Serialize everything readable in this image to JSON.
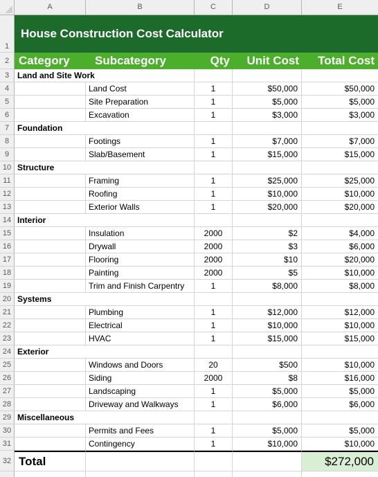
{
  "app": {
    "type": "spreadsheet",
    "colors": {
      "title_bar": "#1d6b2b",
      "header_bar": "#4caf2c",
      "total_highlight": "#d9efd3",
      "gutter": "#efefef",
      "gridline": "#d4d4d4"
    }
  },
  "column_headers": [
    "A",
    "B",
    "C",
    "D",
    "E"
  ],
  "title": {
    "row": "1",
    "text": "House Construction Cost Calculator"
  },
  "table_header": {
    "row": "2",
    "columns": [
      "Category",
      "Subcategory",
      "Qty",
      "Unit Cost",
      "Total Cost"
    ]
  },
  "rows": [
    {
      "row": "3",
      "type": "category",
      "category": "Land and Site Work"
    },
    {
      "row": "4",
      "type": "item",
      "subcategory": "Land Cost",
      "qty": "1",
      "unit_cost": "$50,000",
      "total_cost": "$50,000"
    },
    {
      "row": "5",
      "type": "item",
      "subcategory": "Site Preparation",
      "qty": "1",
      "unit_cost": "$5,000",
      "total_cost": "$5,000"
    },
    {
      "row": "6",
      "type": "item",
      "subcategory": "Excavation",
      "qty": "1",
      "unit_cost": "$3,000",
      "total_cost": "$3,000"
    },
    {
      "row": "7",
      "type": "category",
      "category": "Foundation"
    },
    {
      "row": "8",
      "type": "item",
      "subcategory": "Footings",
      "qty": "1",
      "unit_cost": "$7,000",
      "total_cost": "$7,000"
    },
    {
      "row": "9",
      "type": "item",
      "subcategory": "Slab/Basement",
      "qty": "1",
      "unit_cost": "$15,000",
      "total_cost": "$15,000"
    },
    {
      "row": "10",
      "type": "category",
      "category": "Structure"
    },
    {
      "row": "11",
      "type": "item",
      "subcategory": "Framing",
      "qty": "1",
      "unit_cost": "$25,000",
      "total_cost": "$25,000"
    },
    {
      "row": "12",
      "type": "item",
      "subcategory": "Roofing",
      "qty": "1",
      "unit_cost": "$10,000",
      "total_cost": "$10,000"
    },
    {
      "row": "13",
      "type": "item",
      "subcategory": "Exterior Walls",
      "qty": "1",
      "unit_cost": "$20,000",
      "total_cost": "$20,000"
    },
    {
      "row": "14",
      "type": "category",
      "category": "Interior"
    },
    {
      "row": "15",
      "type": "item",
      "subcategory": "Insulation",
      "qty": "2000",
      "unit_cost": "$2",
      "total_cost": "$4,000"
    },
    {
      "row": "16",
      "type": "item",
      "subcategory": "Drywall",
      "qty": "2000",
      "unit_cost": "$3",
      "total_cost": "$6,000"
    },
    {
      "row": "17",
      "type": "item",
      "subcategory": "Flooring",
      "qty": "2000",
      "unit_cost": "$10",
      "total_cost": "$20,000"
    },
    {
      "row": "18",
      "type": "item",
      "subcategory": "Painting",
      "qty": "2000",
      "unit_cost": "$5",
      "total_cost": "$10,000"
    },
    {
      "row": "19",
      "type": "item",
      "subcategory": "Trim and Finish Carpentry",
      "qty": "1",
      "unit_cost": "$8,000",
      "total_cost": "$8,000"
    },
    {
      "row": "20",
      "type": "category",
      "category": "Systems"
    },
    {
      "row": "21",
      "type": "item",
      "subcategory": "Plumbing",
      "qty": "1",
      "unit_cost": "$12,000",
      "total_cost": "$12,000"
    },
    {
      "row": "22",
      "type": "item",
      "subcategory": "Electrical",
      "qty": "1",
      "unit_cost": "$10,000",
      "total_cost": "$10,000"
    },
    {
      "row": "23",
      "type": "item",
      "subcategory": "HVAC",
      "qty": "1",
      "unit_cost": "$15,000",
      "total_cost": "$15,000"
    },
    {
      "row": "24",
      "type": "category",
      "category": "Exterior"
    },
    {
      "row": "25",
      "type": "item",
      "subcategory": "Windows and Doors",
      "qty": "20",
      "unit_cost": "$500",
      "total_cost": "$10,000"
    },
    {
      "row": "26",
      "type": "item",
      "subcategory": "Siding",
      "qty": "2000",
      "unit_cost": "$8",
      "total_cost": "$16,000"
    },
    {
      "row": "27",
      "type": "item",
      "subcategory": "Landscaping",
      "qty": "1",
      "unit_cost": "$5,000",
      "total_cost": "$5,000"
    },
    {
      "row": "28",
      "type": "item",
      "subcategory": "Driveway and Walkways",
      "qty": "1",
      "unit_cost": "$6,000",
      "total_cost": "$6,000"
    },
    {
      "row": "29",
      "type": "category",
      "category": "Miscellaneous"
    },
    {
      "row": "30",
      "type": "item",
      "subcategory": "Permits and Fees",
      "qty": "1",
      "unit_cost": "$5,000",
      "total_cost": "$5,000"
    },
    {
      "row": "31",
      "type": "item",
      "subcategory": "Contingency",
      "qty": "1",
      "unit_cost": "$10,000",
      "total_cost": "$10,000"
    }
  ],
  "total": {
    "row": "32",
    "label": "Total",
    "value": "$272,000"
  }
}
